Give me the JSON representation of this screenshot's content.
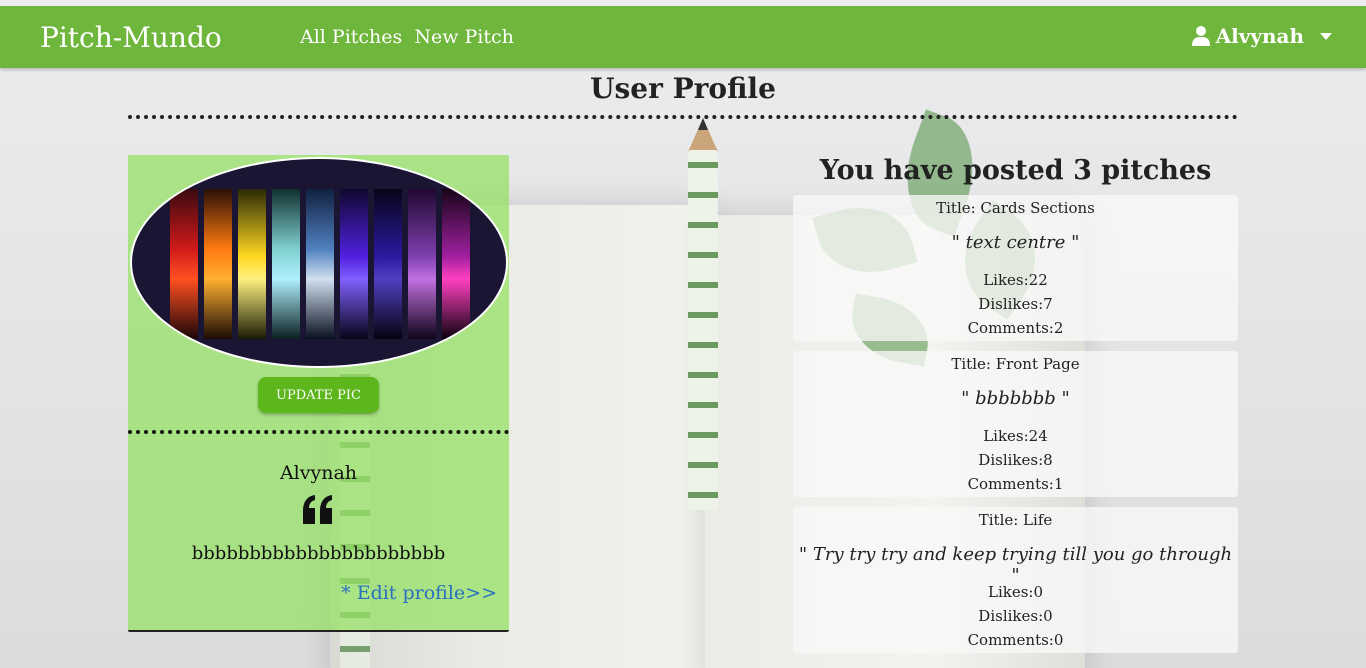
{
  "navbar": {
    "brand": "Pitch-Mundo",
    "links": [
      "All Pitches",
      "New Pitch"
    ],
    "user": "Alvynah",
    "user_icon": "user-icon"
  },
  "page": {
    "title": "User Profile"
  },
  "profile": {
    "update_button": "UPDATE PIC",
    "username": "Alvynah",
    "quote_icon": "quote-left-icon",
    "bio": "bbbbbbbbbbbbbbbbbbbbbb",
    "edit_link": "* Edit profile>>"
  },
  "pitches": {
    "heading": "You have posted 3 pitches",
    "items": [
      {
        "title": "Title: Cards Sections",
        "text": "\" text centre \"",
        "likes": "Likes:22",
        "dislikes": "Dislikes:7",
        "comments": "Comments:2"
      },
      {
        "title": "Title: Front Page",
        "text": "\" bbbbbbb \"",
        "likes": "Likes:24",
        "dislikes": "Dislikes:8",
        "comments": "Comments:1"
      },
      {
        "title": "Title: Life",
        "text": "\" Try try try and keep trying till you go through \"",
        "likes": "Likes:0",
        "dislikes": "Dislikes:0",
        "comments": "Comments:0"
      }
    ]
  },
  "colors": {
    "navbar": "#6fb63d",
    "button": "#5cb61c",
    "card": "#96e164",
    "link": "#2a6fc0"
  }
}
